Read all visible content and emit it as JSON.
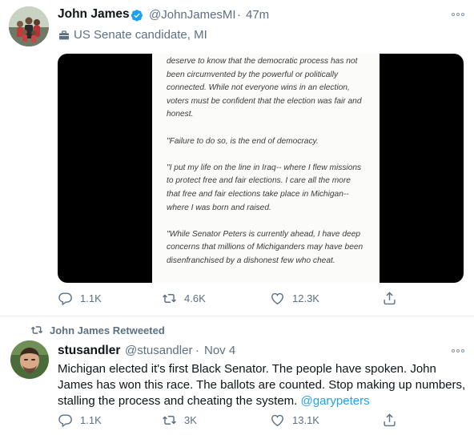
{
  "tweet1": {
    "name": "John James",
    "handle": "@JohnJamesMI",
    "separator": "·",
    "time": "47m",
    "label": "US Senate candidate, MI",
    "document_paragraphs": [
      "deserve to know that the democratic process has not been circumvented by the powerful or politically connected. While not everyone wins in an election, voters must be confident that the election was fair and honest.",
      "\"Failure to do so, is the end of democracy.",
      "\"I put my life on the line in Iraq-- where I flew missions to protect free and fair elections. I care all the more that free and fair elections take place in Michigan-- where I was born and raised.",
      "\"While Senator Peters is currently ahead, I have deep concerns that millions of Michiganders may have been disenfranchised by a dishonest few who cheat."
    ],
    "replies": "1.1K",
    "retweets": "4.6K",
    "likes": "12.3K"
  },
  "retweet_context": {
    "text": "John James Retweeted"
  },
  "tweet2": {
    "name": "stusandler",
    "handle": "@stusandler",
    "separator": "·",
    "time": "Nov 4",
    "text": "Michigan elected it's first Black Senator. The people have spoken.  John James has won this race.  The ballots are counted.  Stop making up numbers, stalling the process and cheating the system. ",
    "mention": "@garypeters",
    "replies": "1.1K",
    "retweets": "3K",
    "likes": "13.1K"
  },
  "colors": {
    "accent": "#1da1f2",
    "muted": "#5b7083",
    "text": "#0f1419",
    "divider": "#e6ecf0"
  },
  "icons": [
    "verified-badge-icon",
    "more-options-icon",
    "briefcase-icon",
    "reply-icon",
    "retweet-icon",
    "like-icon",
    "share-icon"
  ]
}
